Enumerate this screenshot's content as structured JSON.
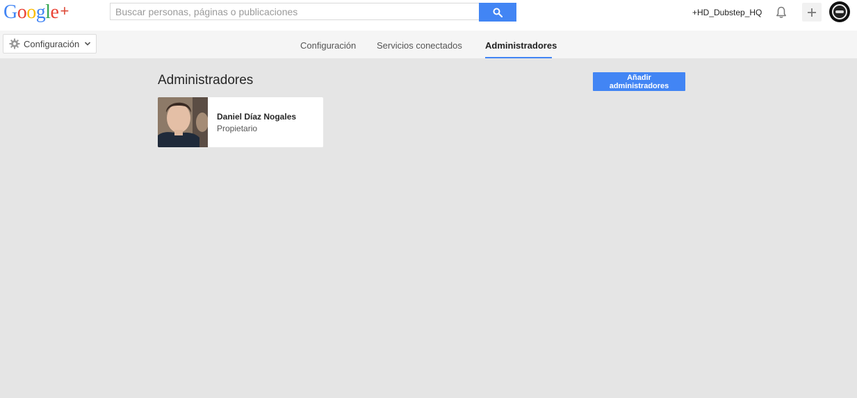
{
  "header": {
    "logo_text": "Google",
    "logo_plus": "+",
    "search_placeholder": "Buscar personas, páginas o publicaciones",
    "search_button_icon": "search-icon",
    "user_name": "+HD_Dubstep_HQ",
    "notification_icon": "bell-icon",
    "add_icon": "plus-icon",
    "avatar_icon": "profile-avatar"
  },
  "subnav": {
    "dropdown_label": "Configuración",
    "dropdown_icon": "gear-icon",
    "tabs": [
      {
        "label": "Configuración",
        "active": false
      },
      {
        "label": "Servicios conectados",
        "active": false
      },
      {
        "label": "Administradores",
        "active": true
      }
    ]
  },
  "main": {
    "title": "Administradores",
    "add_button_label": "Añadir administradores",
    "admins": [
      {
        "name": "Daniel Díaz Nogales",
        "role": "Propietario"
      }
    ]
  },
  "colors": {
    "accent": "#4285f4",
    "background": "#e5e5e5"
  }
}
